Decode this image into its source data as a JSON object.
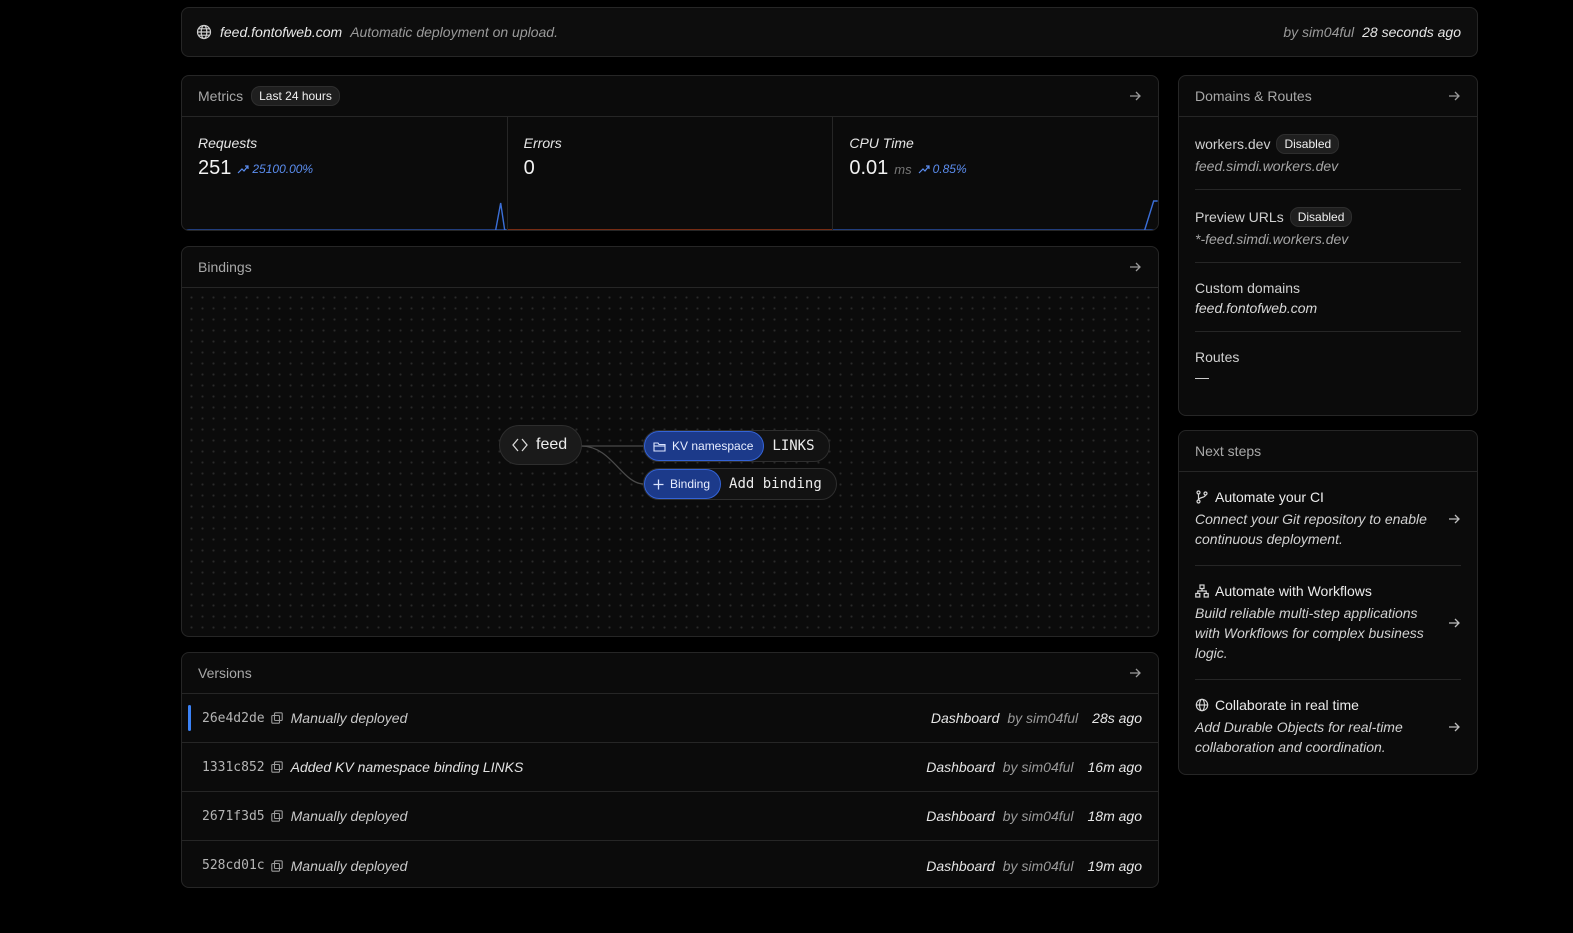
{
  "topbar": {
    "icon": "globe-icon",
    "domain": "feed.fontofweb.com",
    "message": "Automatic deployment on upload.",
    "by": "by sim04ful",
    "time": "28 seconds ago"
  },
  "metrics": {
    "title": "Metrics",
    "range_badge": "Last 24 hours",
    "items": [
      {
        "label": "Requests",
        "value": "251",
        "unit": "",
        "delta": "25100.00%",
        "spark_color": "#3b6fd8",
        "spark_level": 1.0
      },
      {
        "label": "Errors",
        "value": "0",
        "unit": "",
        "delta": "",
        "spark_color": "#c2410c",
        "spark_level": 0
      },
      {
        "label": "CPU Time",
        "value": "0.01",
        "unit": "ms",
        "delta": "0.85%",
        "spark_color": "#3b6fd8",
        "spark_level": 1.0
      }
    ]
  },
  "bindings": {
    "title": "Bindings",
    "worker_name": "feed",
    "kv": {
      "tag": "KV namespace",
      "name": "LINKS"
    },
    "add": {
      "tag": "Binding",
      "name": "Add binding"
    }
  },
  "versions": {
    "title": "Versions",
    "rows": [
      {
        "hash": "26e4d2de",
        "desc": "Manually deployed",
        "source": "Dashboard",
        "by": "by sim04ful",
        "ago": "28s ago",
        "current": true
      },
      {
        "hash": "1331c852",
        "desc": "Added KV namespace binding LINKS",
        "source": "Dashboard",
        "by": "by sim04ful",
        "ago": "16m ago",
        "current": false
      },
      {
        "hash": "2671f3d5",
        "desc": "Manually deployed",
        "source": "Dashboard",
        "by": "by sim04ful",
        "ago": "18m ago",
        "current": false
      },
      {
        "hash": "528cd01c",
        "desc": "Manually deployed",
        "source": "Dashboard",
        "by": "by sim04ful",
        "ago": "19m ago",
        "current": false
      }
    ]
  },
  "domains": {
    "title": "Domains & Routes",
    "sections": [
      {
        "title": "workers.dev",
        "badge": "Disabled",
        "value": "feed.simdi.workers.dev"
      },
      {
        "title": "Preview URLs",
        "badge": "Disabled",
        "value": "*-feed.simdi.workers.dev"
      },
      {
        "title": "Custom domains",
        "badge": "",
        "value": "feed.fontofweb.com"
      },
      {
        "title": "Routes",
        "badge": "",
        "value": "—"
      }
    ]
  },
  "next_steps": {
    "title": "Next steps",
    "items": [
      {
        "icon": "git-branch-icon",
        "title": "Automate your CI",
        "desc": "Connect your Git repository to enable continuous deployment."
      },
      {
        "icon": "workflow-icon",
        "title": "Automate with Workflows",
        "desc": "Build reliable multi-step applications with Workflows for complex business logic."
      },
      {
        "icon": "globe-icon",
        "title": "Collaborate in real time",
        "desc": "Add Durable Objects for real-time collaboration and coordination."
      }
    ]
  }
}
